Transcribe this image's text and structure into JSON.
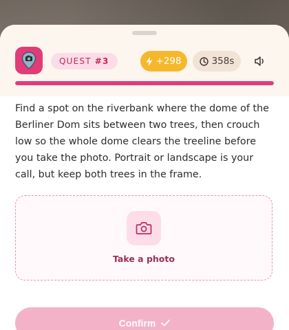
{
  "quest": {
    "label": "QUEST",
    "number": "#3",
    "icon": "camera-pin-icon"
  },
  "stats": {
    "score": "+298",
    "score_icon": "lightning-icon",
    "timer": "358s",
    "timer_icon": "clock-icon",
    "sound_icon": "speaker-icon"
  },
  "progress": {
    "fraction": 1.0
  },
  "instructions": "Find a spot on the riverbank where the dome of the Berliner Dom sits between two trees, then crouch low so the whole dome clears the treeline before you take the photo. Portrait or landscape is your call, but keep both trees in the frame.",
  "photo": {
    "label": "Take a photo",
    "icon": "camera-icon"
  },
  "confirm": {
    "label": "Confirm",
    "icon": "checkmark-icon"
  },
  "colors": {
    "accent": "#e23c78",
    "accent_light": "#fbdde7",
    "score_bg": "#f5b82d",
    "timer_bg": "#f1e3d6",
    "confirm_disabled": "#f4b2c9"
  }
}
